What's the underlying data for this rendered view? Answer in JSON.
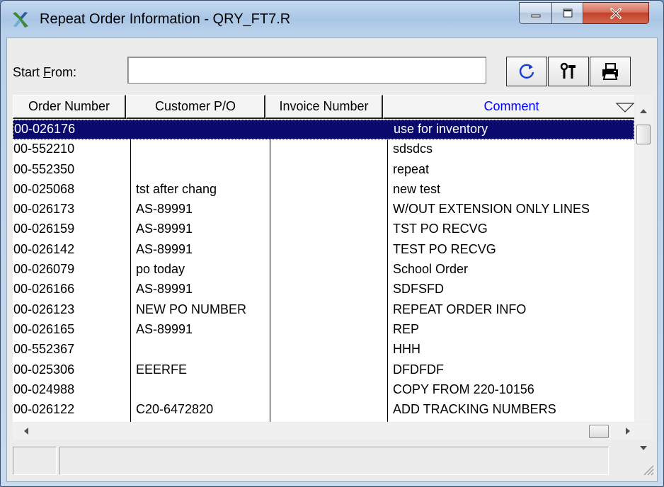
{
  "window": {
    "title": "Repeat Order Information - QRY_FT7.R"
  },
  "search": {
    "label_pre": "Start ",
    "label_accel": "F",
    "label_post": "rom:",
    "value": "",
    "placeholder": ""
  },
  "toolbar": {
    "buttons": [
      {
        "name": "refresh",
        "icon": "refresh-icon"
      },
      {
        "name": "tools",
        "icon": "tools-icon"
      },
      {
        "name": "print",
        "icon": "printer-icon"
      }
    ]
  },
  "table": {
    "columns": [
      "Order Number",
      "Customer P/O",
      "Invoice Number",
      "Comment"
    ],
    "selected_row": 0,
    "rows": [
      {
        "order": "00-026176",
        "po": "",
        "invoice": "",
        "comment": "use for inventory"
      },
      {
        "order": "00-552210",
        "po": "",
        "invoice": "",
        "comment": "sdsdcs"
      },
      {
        "order": "00-552350",
        "po": "",
        "invoice": "",
        "comment": "repeat"
      },
      {
        "order": "00-025068",
        "po": "tst after chang",
        "invoice": "",
        "comment": "new test"
      },
      {
        "order": "00-026173",
        "po": "AS-89991",
        "invoice": "",
        "comment": "W/OUT EXTENSION ONLY LINES"
      },
      {
        "order": "00-026159",
        "po": "AS-89991",
        "invoice": "",
        "comment": "TST PO RECVG"
      },
      {
        "order": "00-026142",
        "po": "AS-89991",
        "invoice": "",
        "comment": "TEST PO RECVG"
      },
      {
        "order": "00-026079",
        "po": "po today",
        "invoice": "",
        "comment": "School Order"
      },
      {
        "order": "00-026166",
        "po": "AS-89991",
        "invoice": "",
        "comment": "SDFSFD"
      },
      {
        "order": "00-026123",
        "po": "NEW PO NUMBER",
        "invoice": "",
        "comment": "REPEAT ORDER INFO"
      },
      {
        "order": "00-026165",
        "po": "AS-89991",
        "invoice": "",
        "comment": "REP"
      },
      {
        "order": "00-552367",
        "po": "",
        "invoice": "",
        "comment": "HHH"
      },
      {
        "order": "00-025306",
        "po": "EEERFE",
        "invoice": "",
        "comment": "DFDFDF"
      },
      {
        "order": "00-024988",
        "po": "",
        "invoice": "",
        "comment": "COPY FROM 220-10156"
      },
      {
        "order": "00-026122",
        "po": "C20-6472820",
        "invoice": "",
        "comment": "ADD TRACKING NUMBERS"
      }
    ]
  },
  "status": {
    "pane1": "",
    "pane2": ""
  },
  "colors": {
    "selection": "#0a0a6e",
    "sorted_header": "#0000ff",
    "close_button": "#c2402a"
  }
}
